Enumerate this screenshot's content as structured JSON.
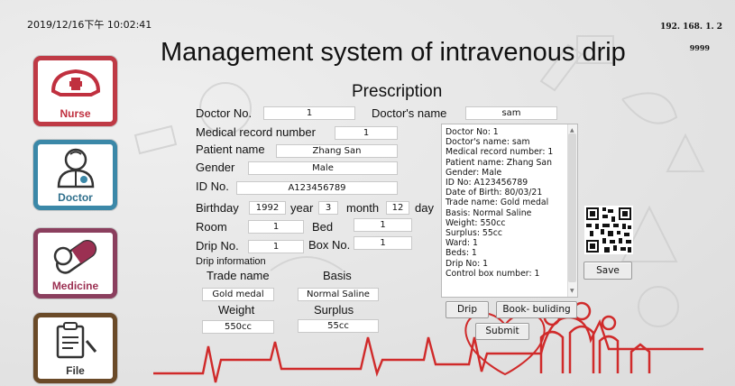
{
  "header": {
    "datetime": "2019/12/16下午 10:02:41",
    "ip": "192. 168. 1. 2",
    "port": "9999",
    "title": "Management system of intravenous drip"
  },
  "sidebar": {
    "items": [
      {
        "label": "Nurse",
        "icon": "nurse-cap-icon"
      },
      {
        "label": "Doctor",
        "icon": "doctor-icon"
      },
      {
        "label": "Medicine",
        "icon": "pill-icon"
      },
      {
        "label": "File",
        "icon": "clipboard-icon"
      }
    ]
  },
  "form": {
    "heading": "Prescription",
    "doctor_no_label": "Doctor No.",
    "doctor_no_value": "1",
    "doctor_name_label": "Doctor's name",
    "doctor_name_value": "sam",
    "medical_record_label": "Medical record number",
    "medical_record_value": "1",
    "patient_name_label": "Patient name",
    "patient_name_value": "Zhang San",
    "gender_label": "Gender",
    "gender_value": "Male",
    "id_label": "ID No.",
    "id_value": "A123456789",
    "birthday_label": "Birthday",
    "birth_year_value": "1992",
    "year_label": "year",
    "birth_month_value": "3",
    "month_label": "month",
    "birth_day_value": "12",
    "day_label": "day",
    "room_label": "Room",
    "room_value": "1",
    "bed_label": "Bed",
    "bed_value": "1",
    "drip_no_label": "Drip No.",
    "drip_no_value": "1",
    "box_no_label": "Box No.",
    "box_no_value": "1",
    "drip_info_label": "Drip information",
    "trade_name_label": "Trade name",
    "trade_name_value": "Gold medal",
    "basis_label": "Basis",
    "basis_value": "Normal Saline",
    "weight_label": "Weight",
    "weight_value": "550cc",
    "surplus_label": "Surplus",
    "surplus_value": "55cc"
  },
  "info_panel": {
    "lines": [
      "Doctor No: 1",
      "Doctor's name: sam",
      "Medical record number: 1",
      "Patient name: Zhang San",
      "Gender: Male",
      "ID No: A123456789",
      "Date of Birth: 80/03/21",
      "Trade name: Gold medal",
      "Basis: Normal Saline",
      "Weight: 550cc",
      "Surplus: 55cc",
      "Ward: 1",
      "Beds: 1",
      "Drip No: 1",
      "Control box number: 1"
    ]
  },
  "buttons": {
    "save": "Save",
    "drip": "Drip",
    "book_building": "Book- buliding",
    "submit": "Submit"
  },
  "colors": {
    "nurse": "#bf3a45",
    "doctor": "#3b88a8",
    "medicine": "#8b3f5e",
    "file": "#6a4a28",
    "heartbeat": "#d02a2a"
  }
}
